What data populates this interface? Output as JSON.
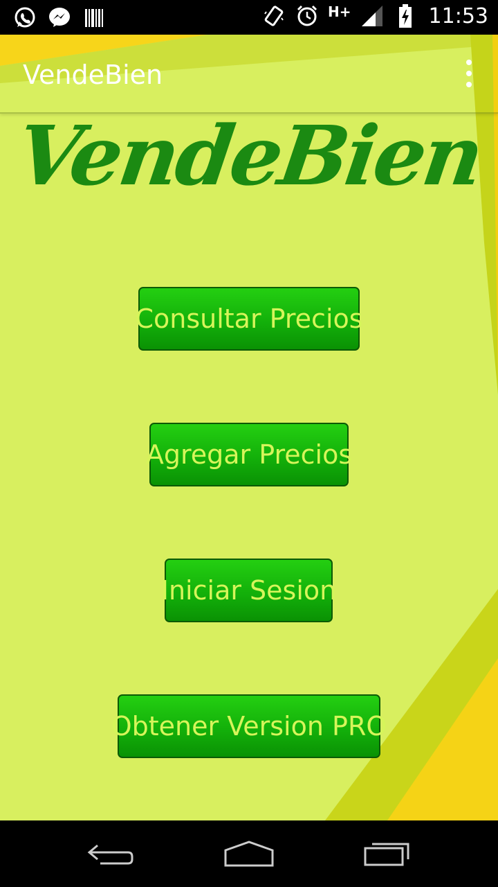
{
  "status_bar": {
    "network_type": "H+",
    "time": "11:53",
    "icons": [
      "whatsapp-icon",
      "messenger-icon",
      "barcode-icon",
      "vibrate-icon",
      "alarm-icon",
      "signal-icon",
      "battery-icon"
    ]
  },
  "action_bar": {
    "title": "VendeBien",
    "overflow_icon": "more-vert-icon"
  },
  "logo": {
    "text": "VendeBien"
  },
  "buttons": {
    "consultar": "Consultar Precios",
    "agregar": "Agregar Precios",
    "iniciar": "Iniciar Sesion",
    "obtener": "Obtener Version PRO"
  },
  "nav_bar": {
    "icons": [
      "back-icon",
      "home-icon",
      "recents-icon"
    ]
  },
  "colors": {
    "background": "#d8ef5f",
    "button_green": "#13b00a",
    "button_text": "#d6f55a",
    "logo_green": "#1b8a12"
  }
}
